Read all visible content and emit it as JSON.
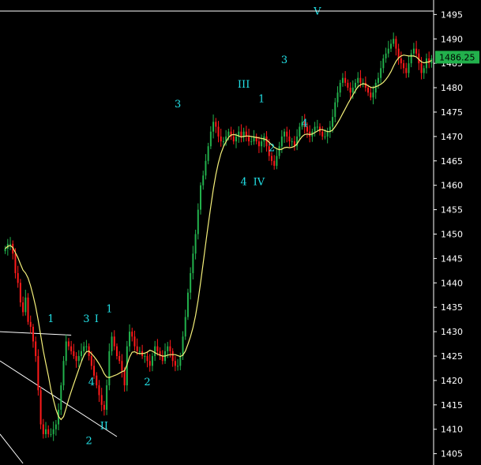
{
  "chart_data": {
    "type": "candlestick",
    "title": "",
    "xlabel": "",
    "ylabel": "",
    "ylim": [
      1403,
      1497
    ],
    "y_ticks": [
      1405,
      1410,
      1415,
      1420,
      1425,
      1430,
      1435,
      1440,
      1445,
      1450,
      1455,
      1460,
      1465,
      1470,
      1475,
      1480,
      1485,
      1490,
      1495
    ],
    "grid": false,
    "axis_position": "right",
    "background_color": "#000000",
    "up_color": "#22b14c",
    "down_color": "#ff1a1a",
    "ma_color": "#f5f07a",
    "annotation_color": "#22e0e6",
    "trendline_color": "#ffffff",
    "last_price": "1486.25",
    "last_price_badge_color": "#22b14c",
    "close_path": [
      1447,
      1448,
      1448,
      1446,
      1442,
      1440,
      1436,
      1434,
      1437,
      1432,
      1431,
      1428,
      1425,
      1418,
      1411,
      1409,
      1410,
      1409,
      1409,
      1410,
      1411,
      1414,
      1419,
      1424,
      1428,
      1427,
      1426,
      1425,
      1424,
      1425,
      1426,
      1427,
      1427,
      1425,
      1423,
      1421,
      1419,
      1417,
      1415,
      1414,
      1419,
      1426,
      1429,
      1427,
      1425,
      1424,
      1422,
      1419,
      1427,
      1430,
      1429,
      1427,
      1426,
      1426,
      1425,
      1425,
      1424,
      1423,
      1425,
      1427,
      1426,
      1425,
      1424,
      1426,
      1427,
      1426,
      1424,
      1423,
      1423,
      1425,
      1429,
      1433,
      1438,
      1442,
      1446,
      1450,
      1455,
      1460,
      1462,
      1465,
      1468,
      1471,
      1473,
      1472,
      1470,
      1469,
      1469,
      1470,
      1471,
      1470,
      1469,
      1470,
      1471,
      1470,
      1471,
      1470,
      1469,
      1469,
      1470,
      1469,
      1468,
      1469,
      1470,
      1468,
      1466,
      1465,
      1464,
      1466,
      1468,
      1470,
      1471,
      1470,
      1469,
      1469,
      1468,
      1470,
      1472,
      1473,
      1472,
      1471,
      1470,
      1471,
      1472,
      1472,
      1471,
      1470,
      1470,
      1471,
      1472,
      1474,
      1477,
      1479,
      1481,
      1482,
      1481,
      1480,
      1479,
      1480,
      1481,
      1482,
      1481,
      1481,
      1480,
      1479,
      1478,
      1479,
      1481,
      1482,
      1484,
      1486,
      1487,
      1488,
      1489,
      1490,
      1488,
      1486,
      1485,
      1484,
      1483,
      1485,
      1487,
      1488,
      1487,
      1485,
      1483,
      1484,
      1486,
      1485,
      1486
    ],
    "annotations": [
      {
        "text": "1",
        "x": 18,
        "y": 1432
      },
      {
        "text": "2",
        "x": 33,
        "y": 1407
      },
      {
        "text": "3",
        "x": 32,
        "y": 1432
      },
      {
        "text": "I",
        "x": 36,
        "y": 1432
      },
      {
        "text": "1",
        "x": 41,
        "y": 1434
      },
      {
        "text": "4",
        "x": 34,
        "y": 1419
      },
      {
        "text": "II",
        "x": 39,
        "y": 1410
      },
      {
        "text": "2",
        "x": 56,
        "y": 1419
      },
      {
        "text": "3",
        "x": 68,
        "y": 1476
      },
      {
        "text": "III",
        "x": 94,
        "y": 1480
      },
      {
        "text": "1",
        "x": 101,
        "y": 1477
      },
      {
        "text": "4",
        "x": 94,
        "y": 1460
      },
      {
        "text": "IV",
        "x": 100,
        "y": 1460
      },
      {
        "text": "2",
        "x": 105,
        "y": 1467
      },
      {
        "text": "3",
        "x": 110,
        "y": 1485
      },
      {
        "text": "4",
        "x": 118,
        "y": 1472
      },
      {
        "text": "V",
        "x": 123,
        "y": 1495
      }
    ]
  }
}
